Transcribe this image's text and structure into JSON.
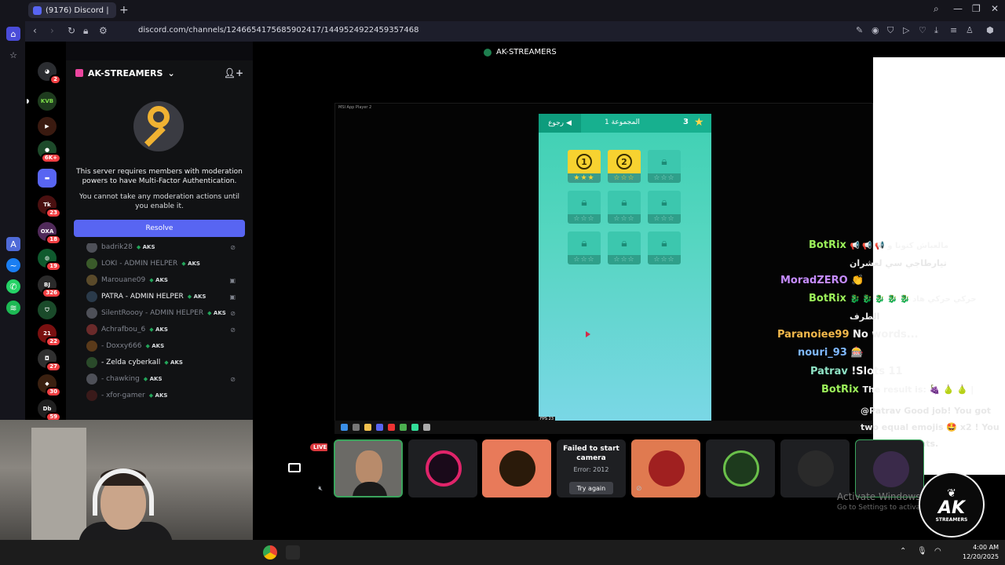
{
  "browser": {
    "tab_title": "(9176) Discord |",
    "url": "discord.com/channels/1246654175685902417/1449524922459357468"
  },
  "server": {
    "name": "AK-STREAMERS",
    "rail_badges": [
      "2",
      "6K+",
      "23",
      "18",
      "19",
      "326",
      "22",
      "27",
      "30",
      "59"
    ]
  },
  "mfa": {
    "message": "This server requires members with moderation powers to have Multi-Factor Authentication.",
    "submessage": "You cannot take any moderation actions until you enable it.",
    "button": "Resolve"
  },
  "members": [
    {
      "name": "badrik28",
      "tag": "AKS",
      "lit": false
    },
    {
      "name": "LOKI - ADMIN HELPER",
      "tag": "AKS",
      "lit": false
    },
    {
      "name": "Marouane09",
      "tag": "AKS",
      "lit": false
    },
    {
      "name": "PATRA - ADMIN HELPER",
      "tag": "AKS",
      "lit": true
    },
    {
      "name": "SilentRoooy - ADMIN HELPER",
      "tag": "AKS",
      "lit": false
    },
    {
      "name": "Achrafbou_6",
      "tag": "AKS",
      "lit": false
    },
    {
      "name": "- Doxxy666",
      "tag": "AKS",
      "lit": false
    },
    {
      "name": "- Zelda cyberkall",
      "tag": "AKS",
      "lit": true
    },
    {
      "name": "- chawking",
      "tag": "AKS",
      "lit": false
    },
    {
      "name": "- xfor-gamer",
      "tag": "AKS",
      "lit": false
    }
  ],
  "stage": {
    "title": "AK-STREAMERS",
    "player_title": "MSI App Player 2",
    "fps": "FPS 23"
  },
  "game": {
    "back": "رجوع",
    "group": "المجموعة 1",
    "score": "3",
    "tiles": [
      {
        "label": "1",
        "locked": false,
        "stars": "★★★"
      },
      {
        "label": "2",
        "locked": false,
        "stars": "☆☆☆"
      },
      {
        "label": "",
        "locked": true,
        "stars": "☆☆☆"
      },
      {
        "label": "",
        "locked": true,
        "stars": "☆☆☆"
      },
      {
        "label": "",
        "locked": true,
        "stars": "☆☆☆"
      },
      {
        "label": "",
        "locked": true,
        "stars": "☆☆☆"
      },
      {
        "label": "",
        "locked": true,
        "stars": "☆☆☆"
      },
      {
        "label": "",
        "locked": true,
        "stars": "☆☆☆"
      },
      {
        "label": "",
        "locked": true,
        "stars": "☆☆☆"
      }
    ]
  },
  "chat": [
    {
      "user": "BotRix",
      "color": "#9cf05a",
      "text": "📢 📢 📢 مالعباش كتونا و",
      "sub": "تيارطاجي سي لعشران"
    },
    {
      "user": "MoradZERO",
      "color": "#c68cff",
      "text": "👏",
      "sub": ""
    },
    {
      "user": "BotRix",
      "color": "#9cf05a",
      "text": "🐉 🐉 🐉 🐉 🐉 حركي حركي هاد",
      "sub": "الطرف"
    },
    {
      "user": "Paranoiee99",
      "color": "#f2b84b",
      "text": "No words...",
      "sub": ""
    },
    {
      "user": "nouri_93",
      "color": "#7fb8ff",
      "text": "🎰",
      "sub": ""
    },
    {
      "user": "Patrav",
      "color": "#8fe3c5",
      "text": "!Slots 11",
      "sub": ""
    },
    {
      "user": "BotRix",
      "color": "#9cf05a",
      "text": "The result is: 🍇 🍐 🍐 |",
      "sub": "@Patrav Good job! You got two equal emojis 🤩 x2 ! You won 100 points."
    }
  ],
  "participants": {
    "live": "LIVE",
    "fail_title": "Failed to start camera",
    "fail_error": "Error: 2012",
    "retry": "Try again"
  },
  "activate": {
    "title": "Activate Windows",
    "sub": "Go to Settings to activate"
  },
  "logo": {
    "big": "AK",
    "small": "STREAMERS"
  },
  "clock": {
    "time": "4:00 AM",
    "date": "12/20/2025"
  }
}
